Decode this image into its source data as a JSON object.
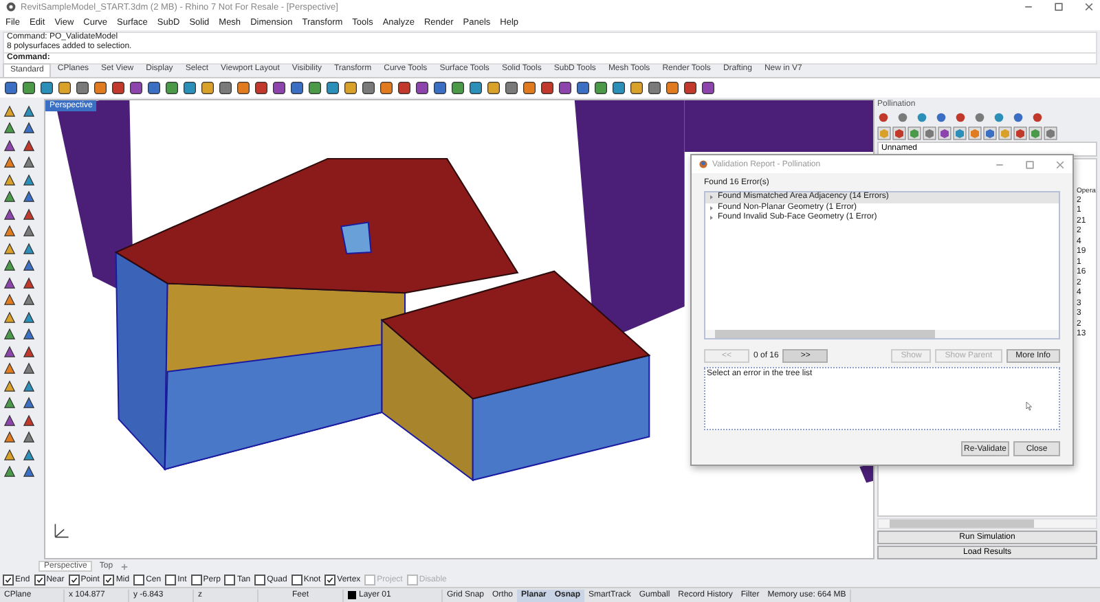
{
  "window": {
    "title": "RevitSampleModel_START.3dm (2 MB) - Rhino 7 Not For Resale - [Perspective]"
  },
  "menu": [
    "File",
    "Edit",
    "View",
    "Curve",
    "Surface",
    "SubD",
    "Solid",
    "Mesh",
    "Dimension",
    "Transform",
    "Tools",
    "Analyze",
    "Render",
    "Panels",
    "Help"
  ],
  "command_history": [
    "Command: PO_ValidateModel",
    "8 polysurfaces added to selection."
  ],
  "command_prompt": {
    "label": "Command:"
  },
  "toolbar_tabs": [
    {
      "label": "Standard",
      "selected": true
    },
    {
      "label": "CPlanes",
      "selected": false
    },
    {
      "label": "Set View",
      "selected": false
    },
    {
      "label": "Display",
      "selected": false
    },
    {
      "label": "Select",
      "selected": false
    },
    {
      "label": "Viewport Layout",
      "selected": false
    },
    {
      "label": "Visibility",
      "selected": false
    },
    {
      "label": "Transform",
      "selected": false
    },
    {
      "label": "Curve Tools",
      "selected": false
    },
    {
      "label": "Surface Tools",
      "selected": false
    },
    {
      "label": "Solid Tools",
      "selected": false
    },
    {
      "label": "SubD Tools",
      "selected": false
    },
    {
      "label": "Mesh Tools",
      "selected": false
    },
    {
      "label": "Render Tools",
      "selected": false
    },
    {
      "label": "Drafting",
      "selected": false
    },
    {
      "label": "New in V7",
      "selected": false
    }
  ],
  "viewport": {
    "label": "Perspective"
  },
  "dialog": {
    "title": "Validation Report - Pollination",
    "summary": "Found 16 Error(s)",
    "tree": [
      {
        "label": "Found Mismatched Area Adjacency (14 Errors)",
        "expanded": false,
        "selected": true
      },
      {
        "label": "Found Non-Planar Geometry (1 Error)",
        "expanded": false,
        "selected": false
      },
      {
        "label": "Found Invalid Sub-Face Geometry (1 Error)",
        "expanded": false,
        "selected": false
      }
    ],
    "prev": {
      "label": "<<",
      "disabled": true
    },
    "counter": "0 of 16",
    "next": {
      "label": ">>",
      "disabled": false
    },
    "actions": [
      {
        "label": "Show",
        "disabled": true
      },
      {
        "label": "Show Parent",
        "disabled": true
      },
      {
        "label": "More Info",
        "disabled": false
      }
    ],
    "details": "Select an error in the tree list",
    "buttons": [
      "Re-Validate",
      "Close"
    ]
  },
  "panel": {
    "title": "Pollination",
    "name_field": {
      "value": "Unnamed"
    },
    "column_header": "Opera",
    "values": [
      "2",
      "1",
      "21",
      "2",
      "4",
      "19",
      "1",
      "16",
      "2",
      "4",
      "3",
      "3",
      "2",
      "13"
    ],
    "buttons": [
      "Run Simulation",
      "Load Results"
    ]
  },
  "view_tabs": [
    {
      "label": "Perspective",
      "selected": true
    },
    {
      "label": "Top",
      "selected": false
    }
  ],
  "osnaps": [
    {
      "label": "End",
      "checked": true,
      "disabled": false
    },
    {
      "label": "Near",
      "checked": true,
      "disabled": false
    },
    {
      "label": "Point",
      "checked": true,
      "disabled": false
    },
    {
      "label": "Mid",
      "checked": true,
      "disabled": false
    },
    {
      "label": "Cen",
      "checked": false,
      "disabled": false
    },
    {
      "label": "Int",
      "checked": false,
      "disabled": false
    },
    {
      "label": "Perp",
      "checked": false,
      "disabled": false
    },
    {
      "label": "Tan",
      "checked": false,
      "disabled": false
    },
    {
      "label": "Quad",
      "checked": false,
      "disabled": false
    },
    {
      "label": "Knot",
      "checked": false,
      "disabled": false
    },
    {
      "label": "Vertex",
      "checked": true,
      "disabled": false
    },
    {
      "label": "Project",
      "checked": false,
      "disabled": true
    },
    {
      "label": "Disable",
      "checked": false,
      "disabled": true
    }
  ],
  "status_bar": [
    {
      "kind": "cell",
      "text": "CPlane"
    },
    {
      "kind": "cell",
      "text": "x 104.877"
    },
    {
      "kind": "cell",
      "text": "y -6.843"
    },
    {
      "kind": "cell",
      "text": "z"
    },
    {
      "kind": "cell",
      "text": "Feet"
    },
    {
      "kind": "layer",
      "text": "Layer 01",
      "color": "#000000"
    },
    {
      "kind": "toggle",
      "text": "Grid Snap",
      "selected": false
    },
    {
      "kind": "toggle",
      "text": "Ortho",
      "selected": false
    },
    {
      "kind": "toggle",
      "text": "Planar",
      "selected": true
    },
    {
      "kind": "toggle",
      "text": "Osnap",
      "selected": true
    },
    {
      "kind": "toggle",
      "text": "SmartTrack",
      "selected": false
    },
    {
      "kind": "toggle",
      "text": "Gumball",
      "selected": false
    },
    {
      "kind": "toggle",
      "text": "Record History",
      "selected": false
    },
    {
      "kind": "toggle",
      "text": "Filter",
      "selected": false
    },
    {
      "kind": "cell",
      "text": "Memory use: 664 MB"
    }
  ]
}
